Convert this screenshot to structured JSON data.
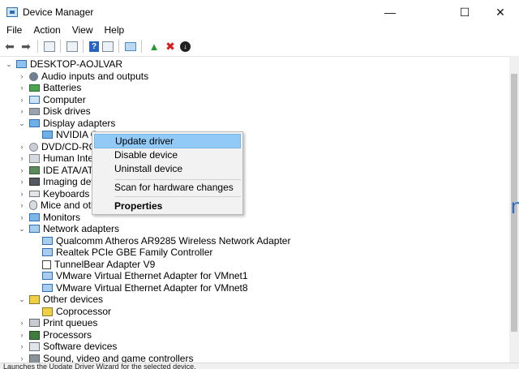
{
  "window": {
    "title": "Device Manager",
    "buttons": {
      "minimize": "—",
      "maximize": "☐",
      "close": "✕"
    }
  },
  "menu": [
    "File",
    "Action",
    "View",
    "Help"
  ],
  "toolbar": {
    "icons": [
      "back-arrow-icon",
      "forward-arrow-icon",
      "properties-pane-icon",
      "list-view-icon",
      "help-icon",
      "console-tree-icon",
      "scan-monitor-icon",
      "update-driver-icon",
      "uninstall-icon",
      "disable-icon"
    ],
    "glyphs": {
      "back": "⬅",
      "forward": "➡",
      "help": "?",
      "update": "▲",
      "uninstall": "✖",
      "disable": "↓"
    }
  },
  "tree": {
    "root": "DESKTOP-AOJLVAR",
    "nodes": [
      "Audio inputs and outputs",
      "Batteries",
      "Computer",
      "Disk drives",
      "Display adapters",
      "NVIDIA Ge",
      "DVD/CD-ROM",
      "Human Interfa",
      "IDE ATA/ATAP",
      "Imaging device",
      "Keyboards",
      "Mice and othe",
      "Monitors",
      "Network adapters",
      "Qualcomm Atheros AR9285 Wireless Network Adapter",
      "Realtek PCIe GBE Family Controller",
      "TunnelBear Adapter V9",
      "VMware Virtual Ethernet Adapter for VMnet1",
      "VMware Virtual Ethernet Adapter for VMnet8",
      "Other devices",
      "Coprocessor",
      "Print queues",
      "Processors",
      "Software devices",
      "Sound, video and game controllers"
    ]
  },
  "context_menu": {
    "items": [
      "Update driver",
      "Disable device",
      "Uninstall device",
      "Scan for hardware changes",
      "Properties"
    ]
  },
  "right_strip_char": "n",
  "status_text": "Launches the Update Driver Wizard for the selected device."
}
